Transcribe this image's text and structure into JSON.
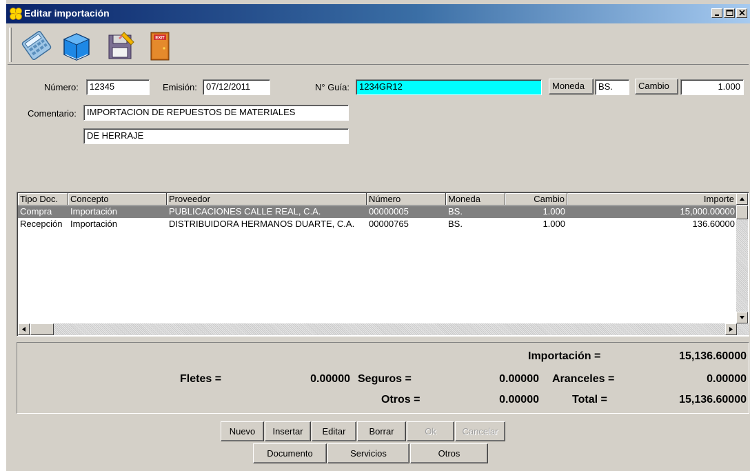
{
  "window": {
    "title": "Editar importación"
  },
  "toolbar": {
    "tools": [
      {
        "name": "calculator-icon"
      },
      {
        "name": "book-icon"
      },
      {
        "name": "floppy-disk-icon"
      },
      {
        "name": "exit-door-icon",
        "text": "EXIT"
      }
    ]
  },
  "header": {
    "numero_label": "Número:",
    "numero": "12345",
    "emision_label": "Emisión:",
    "emision": "07/12/2011",
    "guia_label": "N° Guía:",
    "guia": "1234GR12",
    "moneda_button": "Moneda",
    "moneda": "BS.",
    "cambio_button": "Cambio",
    "cambio": "1.000",
    "comentario_label": "Comentario:",
    "comentario_line1": "IMPORTACION DE REPUESTOS DE MATERIALES",
    "comentario_line2": "DE HERRAJE"
  },
  "grid": {
    "columns": [
      "Tipo Doc.",
      "Concepto",
      "Proveedor",
      "Número",
      "Moneda",
      "Cambio",
      "Importe"
    ],
    "rows": [
      {
        "tipo": "Compra",
        "concepto": "Importación",
        "proveedor": "PUBLICACIONES CALLE REAL, C.A.",
        "numero": "00000005",
        "moneda": "BS.",
        "cambio": "1.000",
        "importe": "15,000.00000",
        "selected": true
      },
      {
        "tipo": "Recepción",
        "concepto": "Importación",
        "proveedor": "DISTRIBUIDORA HERMANOS DUARTE, C.A.",
        "numero": "00000765",
        "moneda": "BS.",
        "cambio": "1.000",
        "importe": "136.60000",
        "selected": false
      }
    ]
  },
  "totals": {
    "importacion_label": "Importación =",
    "importacion": "15,136.60000",
    "fletes_label": "Fletes =",
    "fletes": "0.00000",
    "seguros_label": "Seguros =",
    "seguros": "0.00000",
    "aranceles_label": "Aranceles =",
    "aranceles": "0.00000",
    "otros_label": "Otros =",
    "otros": "0.00000",
    "total_label": "Total =",
    "total": "15,136.60000"
  },
  "actions": {
    "nuevo": "Nuevo",
    "insertar": "Insertar",
    "editar": "Editar",
    "borrar": "Borrar",
    "ok": "Ok",
    "cancelar": "Cancelar",
    "documento": "Documento",
    "servicios": "Servicios",
    "otros": "Otros"
  },
  "colors": {
    "window_bg": "#d4d0c8",
    "title_bar": "#0a246a",
    "guia_highlight": "#00ffff",
    "selected_row": "#808080"
  }
}
